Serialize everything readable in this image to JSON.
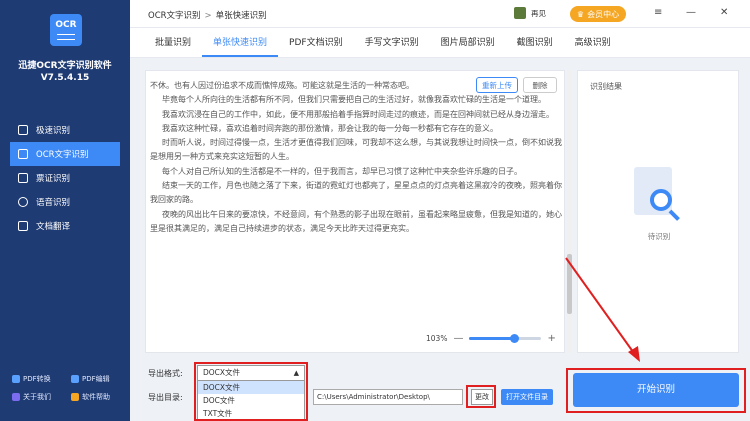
{
  "app": {
    "logo_text": "OCR",
    "name": "迅捷OCR文字识别软件",
    "version": "V7.5.4.15"
  },
  "sidebar": {
    "items": [
      {
        "label": "极速识别",
        "active": false
      },
      {
        "label": "OCR文字识别",
        "active": true
      },
      {
        "label": "票证识别",
        "active": false
      },
      {
        "label": "语音识别",
        "active": false
      },
      {
        "label": "文档翻译",
        "active": false
      }
    ],
    "bottom_links": [
      "PDF转换",
      "PDF编辑",
      "关于我们",
      "软件帮助"
    ]
  },
  "header": {
    "breadcrumb_root": "OCR文字识别",
    "breadcrumb_current": "单张快速识别",
    "user_name": "再见",
    "vip_label": "会员中心",
    "win_menu": "≡",
    "win_min": "—",
    "win_close": "✕"
  },
  "tabs": [
    {
      "label": "批量识别",
      "active": false
    },
    {
      "label": "单张快速识别",
      "active": true
    },
    {
      "label": "PDF文档识别",
      "active": false
    },
    {
      "label": "手写文字识别",
      "active": false
    },
    {
      "label": "图片局部识别",
      "active": false
    },
    {
      "label": "截图识别",
      "active": false
    },
    {
      "label": "高级识别",
      "active": false
    }
  ],
  "editor": {
    "reupload_label": "重新上传",
    "delete_label": "删除",
    "paragraphs": [
      "不休。也有人因过份追求不成而憔悴成殇。可能这就是生活的一种常态吧。",
      "毕竟每个人所向往的生活都有所不同，但我们只需要把自己的生活过好，就像我喜欢忙碌的生活是一个道理。",
      "我喜欢沉浸在自己的工作中，如此，便不用那般掐着手指算时间走过的痕迹，而是在回神间就已经从身边溜走。",
      "我喜欢这种忙碌，喜欢追着时间奔跑的那份激情，那会让我的每一分每一秒都有它存在的意义。",
      "时而听人说，时间过得慢一点，生活才更值得我们回味，可我却不这么想，与其说我想让时间快一点，倒不如说我是想用另一种方式来充实这短暂的人生。",
      "每个人对自己所认知的生活都是不一样的，但于我而言，却早已习惯了这种忙中夹杂些许乐趣的日子。",
      "结束一天的工作，月色也随之落了下来，街道的霓虹灯也都亮了，星星点点的灯点亮着这黑寂冷的夜晚，照亮着你我回家的路。",
      "夜晚的风出比午日来的要凉快，不经意间，有个熟悉的影子出现在眼前，虽看起来略显疲惫，但我是知道的，她心里是很其满足的，满足自己持续进步的状态，满足今天比昨天过得更充实。"
    ],
    "zoom_percent": "103%",
    "zoom_minus": "—",
    "zoom_plus": "+",
    "zoom_fraction": 0.62
  },
  "result": {
    "title": "识别结果",
    "pending": "待识别"
  },
  "export": {
    "format_label": "导出格式:",
    "format_value": "DOCX文件",
    "format_options": [
      "DOCX文件",
      "DOC文件",
      "TXT文件"
    ],
    "dir_label": "导出目录:",
    "dir_value": "C:\\Users\\Administrator\\Desktop\\",
    "change_label": "更改",
    "open_dir_label": "打开文件目录",
    "start_label": "开始识别"
  },
  "colors": {
    "sidebar_bg": "#1f3b73",
    "accent": "#3d8af7",
    "highlight_red": "#e02020",
    "vip": "#f5a623"
  }
}
